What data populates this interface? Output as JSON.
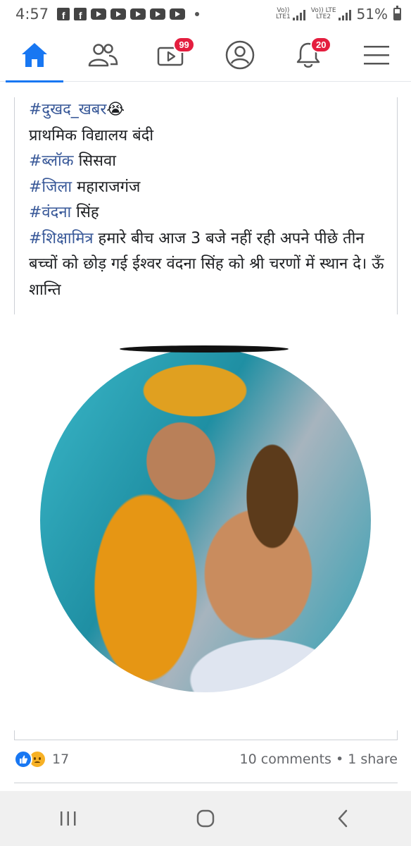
{
  "status_bar": {
    "time": "4:57",
    "sim1": {
      "top": "Vo))",
      "bottom": "LTE1"
    },
    "sim2": {
      "top": "Vo)) LTE",
      "bottom": "LTE2"
    },
    "battery_percent": "51%"
  },
  "nav": {
    "watch_badge": "99",
    "notifications_badge": "20"
  },
  "post": {
    "lines": [
      {
        "tag": "#दुखद_खबर",
        "text": "😭"
      },
      {
        "tag": "",
        "text": "प्राथमिक विद्यालय बंदी"
      },
      {
        "tag": "#ब्लॉक",
        "text": " सिसवा"
      },
      {
        "tag": "#जिला",
        "text": " महाराजगंज"
      },
      {
        "tag": "#वंदना",
        "text": " सिंह"
      },
      {
        "tag": "#शिक्षामित्र",
        "text": " हमारे बीच आज 3 बजे नहीं रही अपने पीछे तीन बच्चों को छोड़ गई ईश्वर वंदना सिंह को श्री चरणों में स्थान दे। ऊँ शान्ति"
      }
    ]
  },
  "reactions": {
    "count": "17",
    "comments_shares": "10 comments • 1 share"
  },
  "colors": {
    "accent": "#1877f2",
    "hashtag": "#385898",
    "badge": "#e41e3f"
  }
}
